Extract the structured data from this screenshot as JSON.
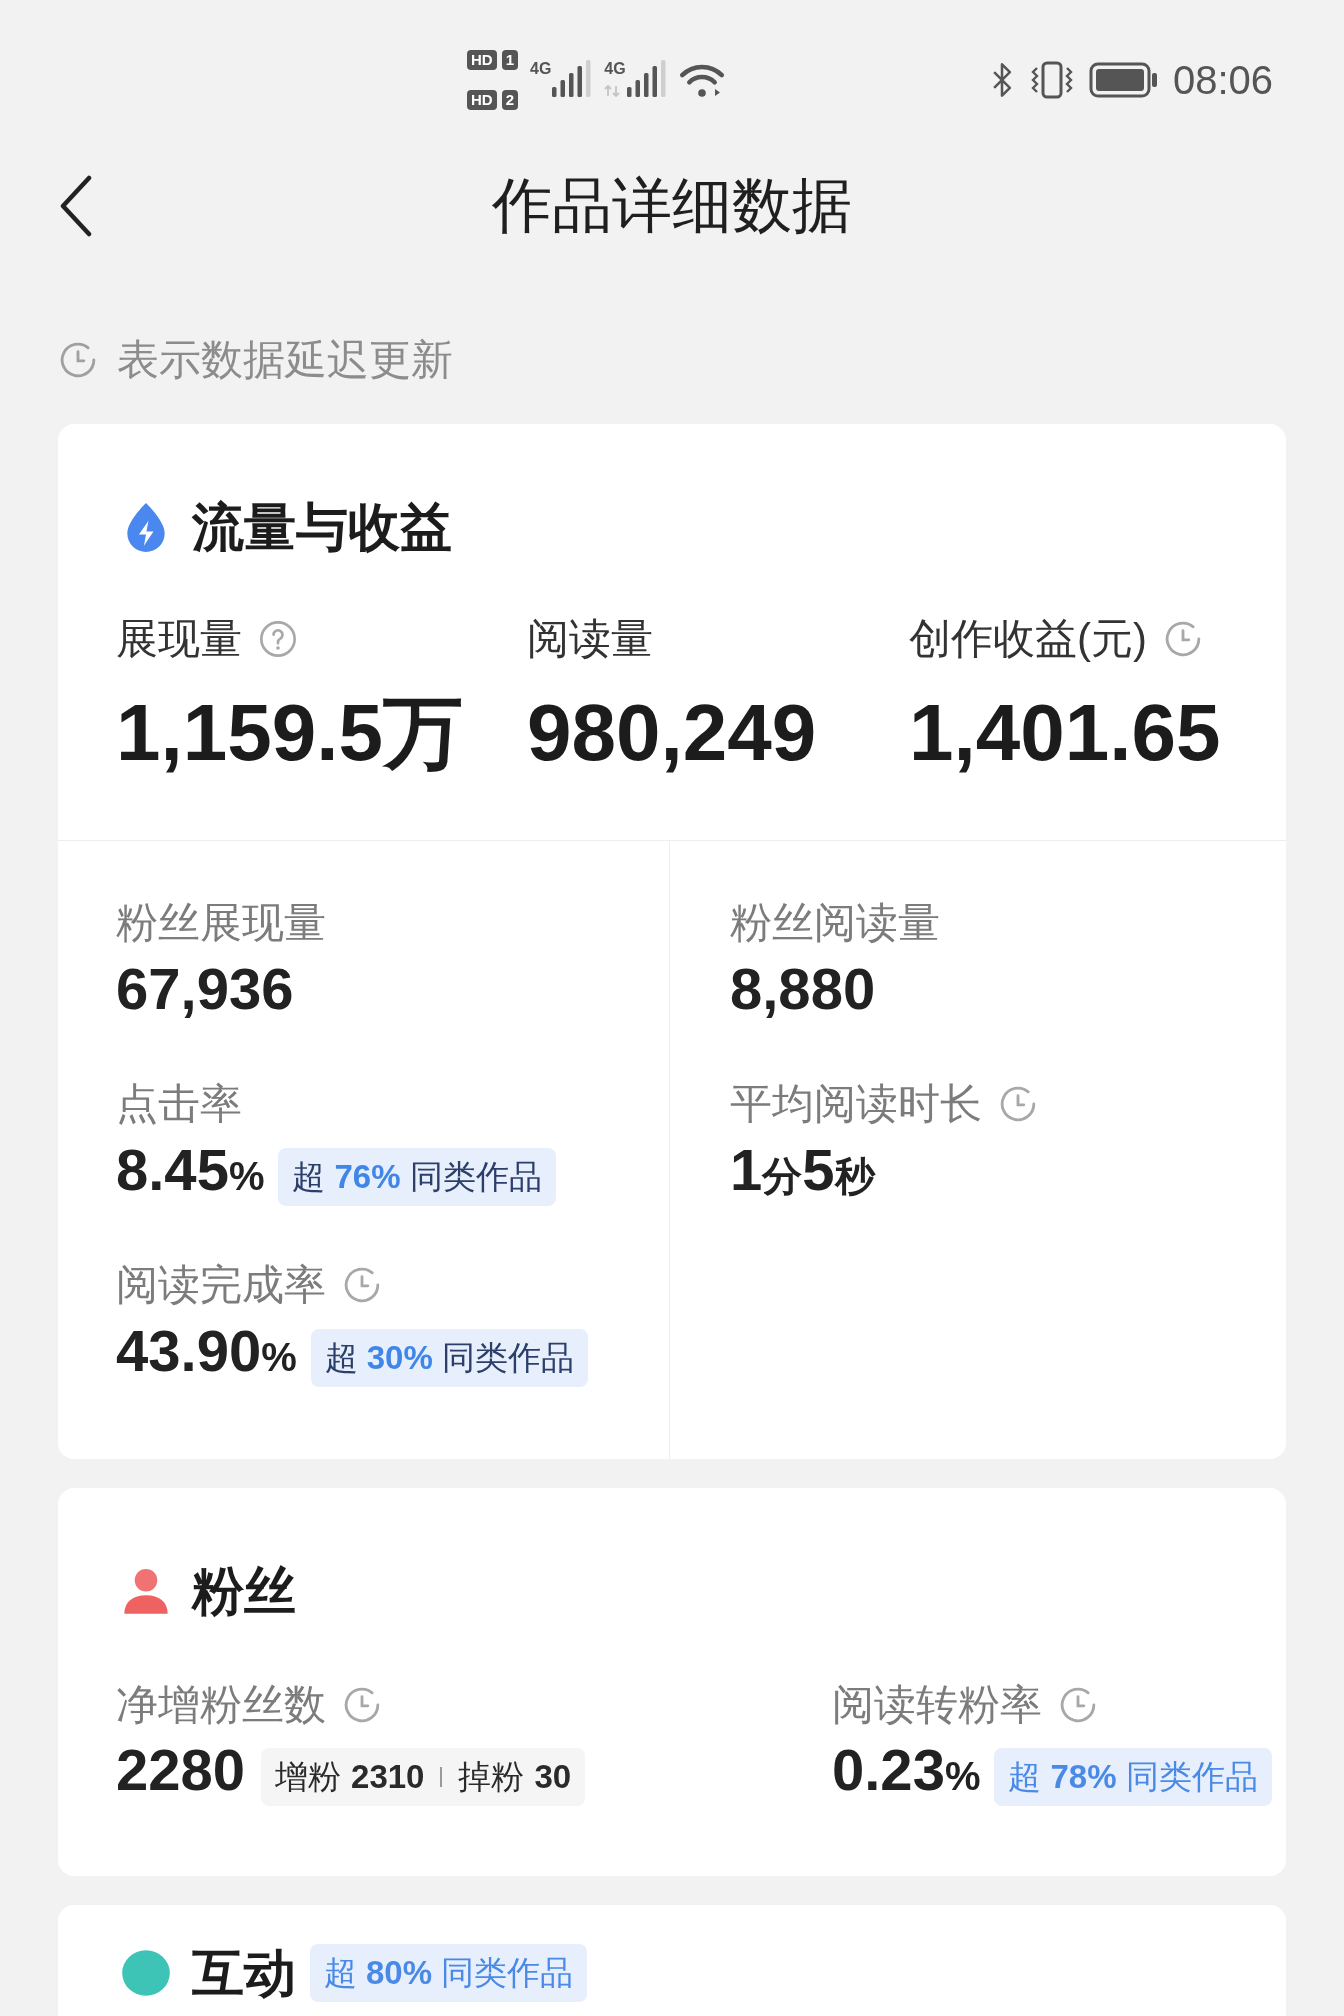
{
  "status_bar": {
    "sims": [
      {
        "hd": "HD",
        "slot": "1",
        "network": "4G",
        "data": false
      },
      {
        "hd": "HD",
        "slot": "2",
        "network": "4G",
        "data": true
      }
    ],
    "time": "08:06"
  },
  "nav": {
    "title": "作品详细数据"
  },
  "notice": "表示数据延迟更新",
  "sections": [
    {
      "kind": "traffic",
      "title": "流量与收益",
      "headline_metrics": [
        {
          "label": "展现量",
          "help": true,
          "delayed": false,
          "value": "1,159.5万"
        },
        {
          "label": "阅读量",
          "help": false,
          "delayed": false,
          "value": "980,249"
        },
        {
          "label": "创作收益(元)",
          "help": false,
          "delayed": true,
          "value": "1,401.65"
        }
      ],
      "columns": [
        [
          {
            "label": "粉丝展现量",
            "delayed": false,
            "value": [
              "67,936"
            ]
          },
          {
            "label": "点击率",
            "delayed": false,
            "value": [
              "8.45",
              "%"
            ],
            "badge": {
              "lead": "超",
              "figure": "76%",
              "tail": "同类作品",
              "full_accent": false
            }
          },
          {
            "label": "阅读完成率",
            "delayed": true,
            "value": [
              "43.90",
              "%"
            ],
            "badge": {
              "lead": "超",
              "figure": "30%",
              "tail": "同类作品",
              "full_accent": false
            }
          }
        ],
        [
          {
            "label": "粉丝阅读量",
            "delayed": false,
            "value": [
              "8,880"
            ]
          },
          {
            "label": "平均阅读时长",
            "delayed": true,
            "value": [
              "1",
              "分",
              "5",
              "秒"
            ]
          }
        ]
      ]
    },
    {
      "kind": "followers",
      "title": "粉丝",
      "metrics": [
        {
          "label": "净增粉丝数",
          "delayed": true,
          "value": [
            "2280"
          ],
          "breakdown": [
            {
              "label": "增粉",
              "value": "2310"
            },
            {
              "label": "掉粉",
              "value": "30"
            }
          ]
        },
        {
          "label": "阅读转粉率",
          "delayed": true,
          "value": [
            "0.23",
            "%"
          ],
          "badge": {
            "lead": "超",
            "figure": "78%",
            "tail": "同类作品",
            "full_accent": true
          }
        }
      ]
    },
    {
      "kind": "engagement",
      "title": "互动",
      "badge": {
        "lead": "超",
        "figure": "80%",
        "tail": "同类作品",
        "full_accent": true
      }
    }
  ]
}
